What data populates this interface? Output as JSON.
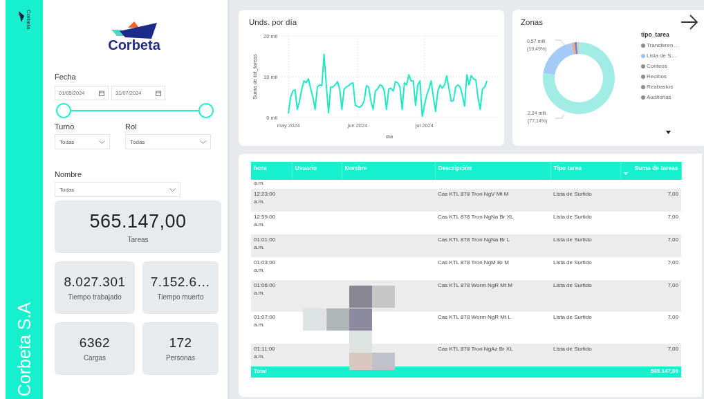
{
  "sidebar": {
    "logo_text": "Corbeta",
    "vertical_title": "Corbeta S.A"
  },
  "filters": {
    "wordmark": "Corbeta",
    "date": {
      "label": "Fecha",
      "from": "01/05/2024",
      "to": "31/07/2024",
      "thumbs": [
        {
          "level": 0
        },
        {
          "level": 1
        }
      ]
    },
    "dropdowns": [
      {
        "label": "Turno",
        "value": "Todas"
      },
      {
        "label": "Rol",
        "value": "Todas"
      },
      {
        "label": "Nombre",
        "value": "Todas"
      }
    ]
  },
  "kpis": [
    {
      "value": "565.147,00",
      "label": "Tareas",
      "kind": "wide"
    },
    {
      "value": "8.027.301",
      "label": "Tiempo trabajado",
      "kind": "half"
    },
    {
      "value": "7.152.6…",
      "label": "Tiempo muerto",
      "kind": "half"
    },
    {
      "value": "6362",
      "label": "Cargas",
      "kind": "half"
    },
    {
      "value": "172",
      "label": "Personas",
      "kind": "half"
    }
  ],
  "line_chart": {
    "title": "Unds. por día",
    "chart_data": {
      "type": "line",
      "xlabel": "día",
      "ylabel": "Suma de tot_tareas",
      "ylim": [
        0,
        20
      ],
      "grid": true,
      "categories": [
        "may 2024",
        null,
        null,
        null,
        null,
        null,
        null,
        null,
        null,
        null,
        null,
        null,
        null,
        null,
        null,
        null,
        null,
        null,
        null,
        null,
        null,
        null,
        null,
        null,
        null,
        null,
        null,
        null,
        null,
        null,
        null,
        "jun 2024",
        null,
        null,
        null,
        null,
        null,
        null,
        null,
        null,
        null,
        null,
        null,
        null,
        null,
        null,
        null,
        null,
        null,
        null,
        null,
        null,
        null,
        null,
        null,
        null,
        null,
        null,
        null,
        null,
        null,
        "jul 2024",
        null,
        null,
        null,
        null,
        null,
        null,
        null,
        null,
        null,
        null,
        null,
        null,
        null,
        null,
        null,
        null,
        null,
        null,
        null,
        null,
        null,
        null,
        null,
        null,
        null,
        null,
        null,
        null
      ],
      "yticks": [
        {
          "value": 0,
          "label": "0 mil"
        },
        {
          "value": 10,
          "label": "10 mil"
        },
        {
          "value": 20,
          "label": "20 mil"
        }
      ],
      "series": [
        {
          "color": "#1de9c4",
          "values": [
            1,
            5,
            6.5,
            6.8,
            2,
            4,
            7,
            9,
            8.5,
            9.5,
            7,
            5,
            2,
            7.5,
            8,
            7.8,
            15.5,
            8,
            1.2,
            7.5,
            7.5,
            8,
            8.8,
            7,
            2,
            7,
            7.5,
            7.8,
            8.3,
            8.5,
            3,
            2.7,
            2.5,
            3,
            4.2,
            7.8,
            7.5,
            4,
            2,
            6.5,
            7,
            8,
            7.8,
            6.5,
            2,
            7,
            7.2,
            6.5,
            8.8,
            8.5,
            7.5,
            2,
            8.5,
            8,
            10.5,
            9,
            9,
            3,
            8,
            9,
            0.3,
            3,
            5.5,
            7,
            9,
            5,
            1.5,
            6.5,
            8,
            7.2,
            8,
            10.2,
            7,
            4,
            4.2,
            7.5,
            8,
            7.5,
            5.5,
            2.8,
            10.5,
            8,
            10.3,
            9.5,
            9.2,
            5,
            2,
            7,
            7.5,
            9
          ]
        }
      ]
    }
  },
  "donut": {
    "title": "Zonas",
    "legend": [
      {
        "color": "#8c8c8c"
      },
      {
        "color": "#8fc3f7"
      },
      {
        "color": "#8c8c8c"
      },
      {
        "color": "#8c8c8c"
      },
      {
        "color": "#8c8c8c"
      },
      {
        "color": "#8c8c8c"
      }
    ],
    "slice_labels": [
      {
        "amount": "0,57 mill.",
        "share": "(19,49%)"
      },
      {
        "amount": "2,24 mill.",
        "share": "(77,14%)"
      }
    ],
    "chart_data": {
      "type": "donut",
      "categories": [
        "Transferen…",
        "Lista de S…",
        "Conteos",
        "Recibos",
        "Reabastos",
        "Auditorias"
      ],
      "series": [
        {
          "name": "tipo_tarea",
          "values": [
            77.14,
            19.49,
            1.5,
            1.0,
            0.5,
            0.37
          ]
        }
      ]
    }
  },
  "table": {
    "columns": [
      {
        "label": "hora",
        "sorted": false
      },
      {
        "label": "Usuario",
        "sorted": false
      },
      {
        "label": "Nombre",
        "sorted": false
      },
      {
        "label": "Descripción",
        "sorted": false
      },
      {
        "label": "Tipo tarea",
        "sorted": false
      },
      {
        "label": "Suma de tareas",
        "sorted": true
      }
    ],
    "rows": [
      {
        "hora": "a.m.",
        "kind": "partial"
      },
      {
        "hora": "12:23:00 a.m.",
        "descripcion": "Cas KTL 878 Tron NgV Mt M",
        "tipo": "Lista de Surtido",
        "suma": "7,00",
        "kind": "normal"
      },
      {
        "hora": "12:59:00 a.m.",
        "descripcion": "Cas KTL 878 Tron NgNa Br XL",
        "tipo": "Lista de Surtido",
        "suma": "7,00",
        "kind": "normal"
      },
      {
        "hora": "01:01:00 a.m.",
        "descripcion": "Cas KTL 878 Tron NgNa Br L",
        "tipo": "Lista de Surtido",
        "suma": "7,00",
        "kind": "normal"
      },
      {
        "hora": "01:03:00 a.m.",
        "descripcion": "Cas KTL 878 Tron NgM Br M",
        "tipo": "Lista de Surtido",
        "suma": "7,00",
        "kind": "normal"
      },
      {
        "hora": "01:06:00 a.m.",
        "descripcion": "Cas KTL 878 Worm NgR Mt M",
        "tipo": "Lista de Surtido",
        "suma": "7,00",
        "kind": "tall"
      },
      {
        "hora": "01:07:00 a.m.",
        "descripcion": "Cas KTL 878 Worm NgR Mt L",
        "tipo": "Lista de Surtido",
        "suma": "7,00",
        "kind": "tall"
      },
      {
        "hora": "01:11:00 a.m.",
        "descripcion": "Cas KTL 878 Tron NgAz Br XL",
        "tipo": "Lista de Surtido",
        "suma": "7,00",
        "kind": "normal"
      }
    ],
    "total": {
      "label": "Total",
      "value": "565.147,00"
    }
  }
}
